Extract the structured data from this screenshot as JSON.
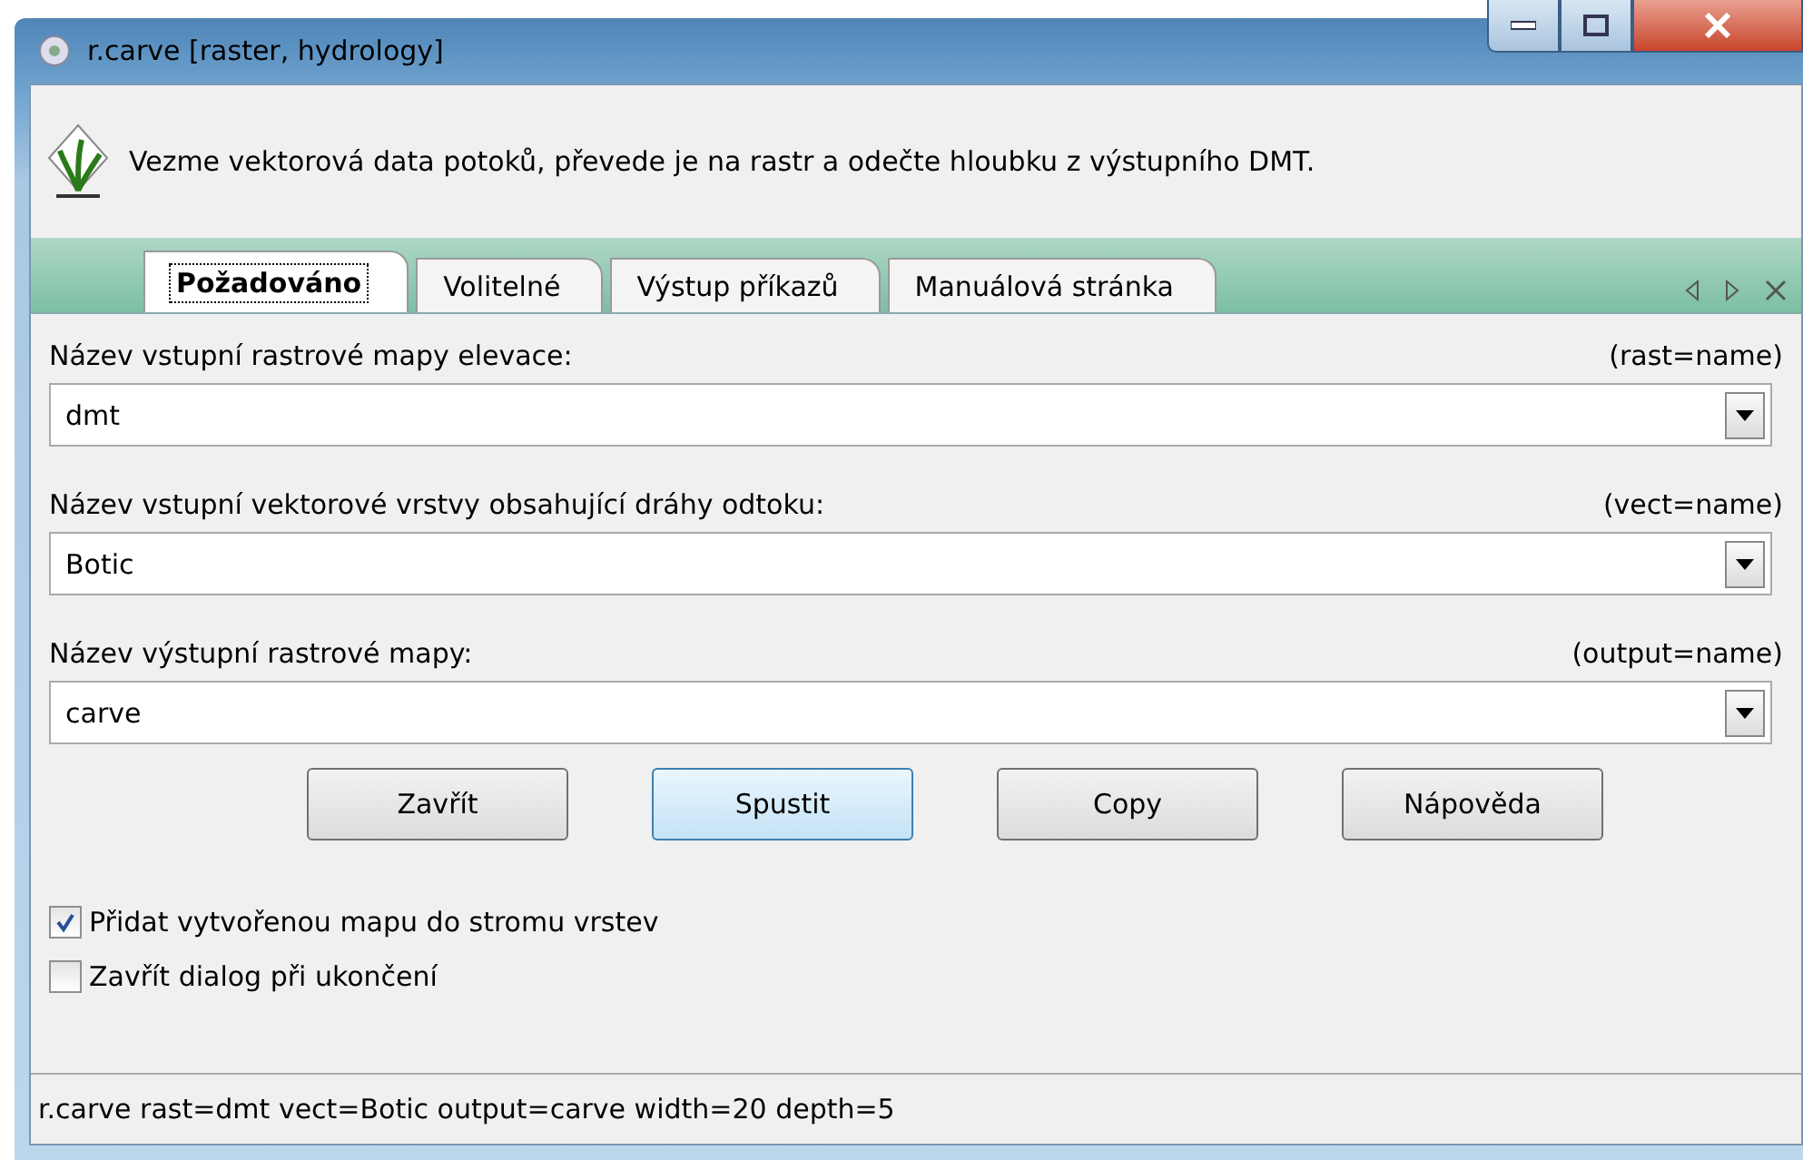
{
  "window": {
    "title": "r.carve [raster, hydrology]"
  },
  "description": "Vezme vektorová data potoků, převede je na rastr a odečte hloubku z výstupního DMT.",
  "tabs": [
    {
      "label": "Požadováno",
      "selected": true
    },
    {
      "label": "Volitelné",
      "selected": false
    },
    {
      "label": "Výstup příkazů",
      "selected": false
    },
    {
      "label": "Manuálová stránka",
      "selected": false
    }
  ],
  "fields": [
    {
      "label": "Název vstupní rastrové mapy elevace:",
      "param": "(rast=name)",
      "value": "dmt"
    },
    {
      "label": "Název vstupní vektorové vrstvy obsahující dráhy odtoku:",
      "param": "(vect=name)",
      "value": "Botic"
    },
    {
      "label": "Název výstupní rastrové mapy:",
      "param": "(output=name)",
      "value": "carve"
    }
  ],
  "buttons": [
    {
      "label": "Zavřít",
      "selected": false
    },
    {
      "label": "Spustit",
      "selected": true
    },
    {
      "label": "Copy",
      "selected": false
    },
    {
      "label": "Nápověda",
      "selected": false
    }
  ],
  "checkboxes": [
    {
      "label": "Přidat vytvořenou mapu do stromu vrstev",
      "checked": true
    },
    {
      "label": "Zavřít dialog při ukončení",
      "checked": false
    }
  ],
  "status_bar": "r.carve rast=dmt vect=Botic output=carve width=20 depth=5"
}
